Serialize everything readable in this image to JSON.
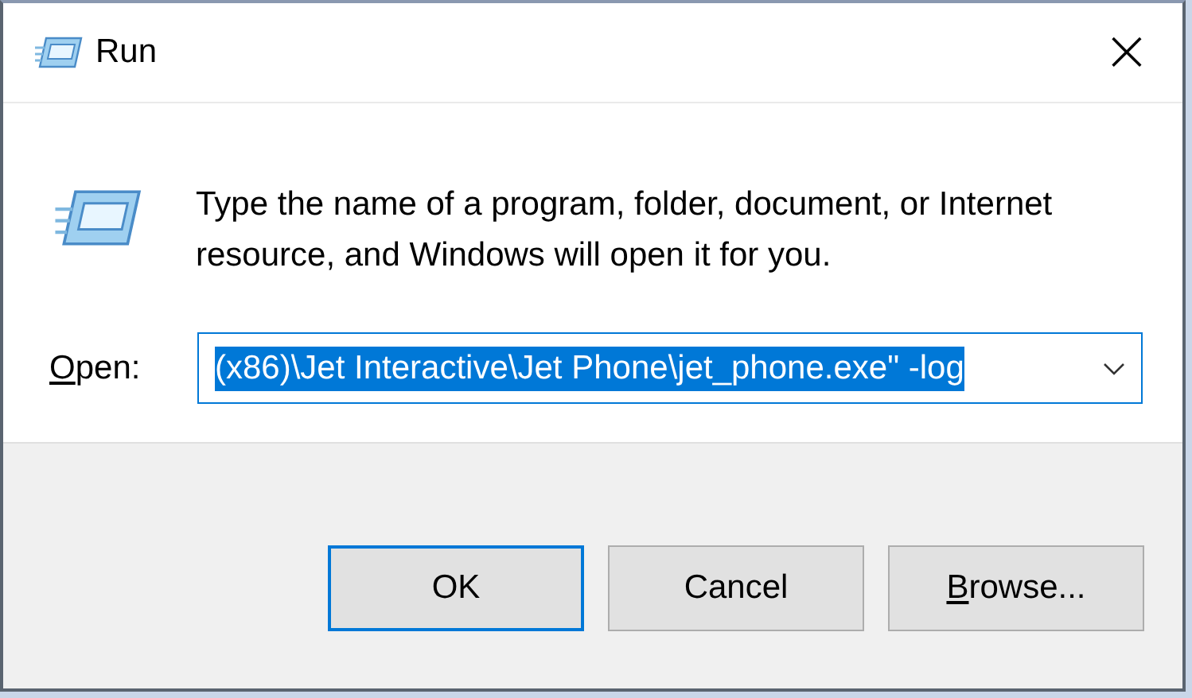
{
  "window": {
    "title": "Run",
    "close": "×"
  },
  "description": "Type the name of a program, folder, document, or Internet resource, and Windows will open it for you.",
  "open_field": {
    "access_key": "O",
    "label_rest": "pen:",
    "value": "(x86)\\Jet Interactive\\Jet Phone\\jet_phone.exe\" -log",
    "selected": true
  },
  "buttons": [
    {
      "label": "OK",
      "default": true
    },
    {
      "label": "Cancel",
      "default": false
    },
    {
      "access_key": "B",
      "label": "rowse...",
      "default": false
    }
  ]
}
